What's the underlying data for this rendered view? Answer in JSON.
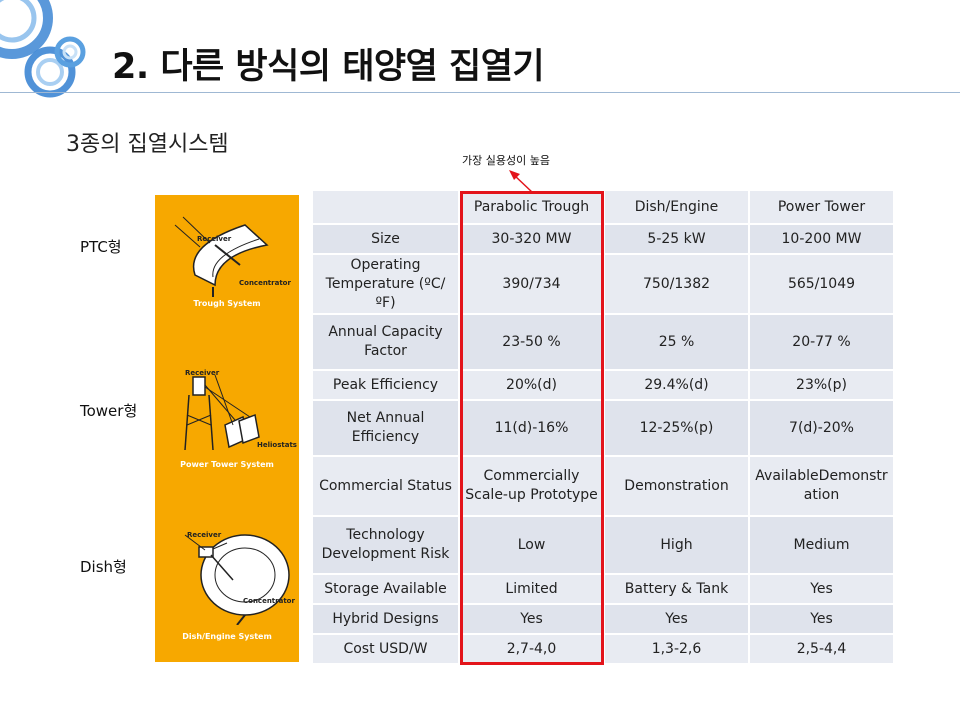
{
  "slide": {
    "title": "2. 다른 방식의 태양열 집열기",
    "subtitle": "3종의 집열시스템",
    "annotation": "가장 실용성이 높음"
  },
  "systems": [
    {
      "label": "PTC형",
      "illustration_caption": "Trough System",
      "parts": [
        "Receiver",
        "Concentrator"
      ]
    },
    {
      "label": "Tower형",
      "illustration_caption": "Power Tower System",
      "parts": [
        "Receiver",
        "Heliostats"
      ]
    },
    {
      "label": "Dish형",
      "illustration_caption": "Dish/Engine System",
      "parts": [
        "Receiver",
        "Concentrator"
      ]
    }
  ],
  "table": {
    "headers": [
      "",
      "Parabolic  Trough",
      "Dish/Engine",
      "Power  Tower"
    ],
    "rows": [
      {
        "label": "Size",
        "values": [
          "30-320 MW",
          "5-25 kW",
          "10-200 MW"
        ]
      },
      {
        "label": "Operating Temperature (ºC/ºF)",
        "values": [
          "390/734",
          "750/1382",
          "565/1049"
        ]
      },
      {
        "label": "Annual Capacity Factor",
        "values": [
          "23-50 %",
          "25 %",
          "20-77 %"
        ]
      },
      {
        "label": "Peak Efficiency",
        "values": [
          "20%(d)",
          "29.4%(d)",
          "23%(p)"
        ]
      },
      {
        "label": "Net Annual Efficiency",
        "values": [
          "11(d)-16%",
          "12-25%(p)",
          "7(d)-20%"
        ]
      },
      {
        "label": "Commercial Status",
        "values": [
          "Commercially Scale-up Prototype",
          "Demonstration",
          "AvailableDemonstration"
        ]
      },
      {
        "label": "Technology Development Risk",
        "values": [
          "Low",
          "High",
          "Medium"
        ]
      },
      {
        "label": "Storage Available",
        "values": [
          "Limited",
          "Battery & Tank",
          "Yes"
        ]
      },
      {
        "label": "Hybrid Designs",
        "values": [
          "Yes",
          "Yes",
          "Yes"
        ]
      },
      {
        "label": "Cost USD/W",
        "values": [
          "2,7-4,0",
          "1,3-2,6",
          "2,5-4,4"
        ]
      }
    ]
  },
  "colors": {
    "sidebar_bg": "#f7a800",
    "highlight_border": "#e3141b",
    "table_cell_bg": "#e8ebf2",
    "deco_circle": "#4a90d9"
  }
}
